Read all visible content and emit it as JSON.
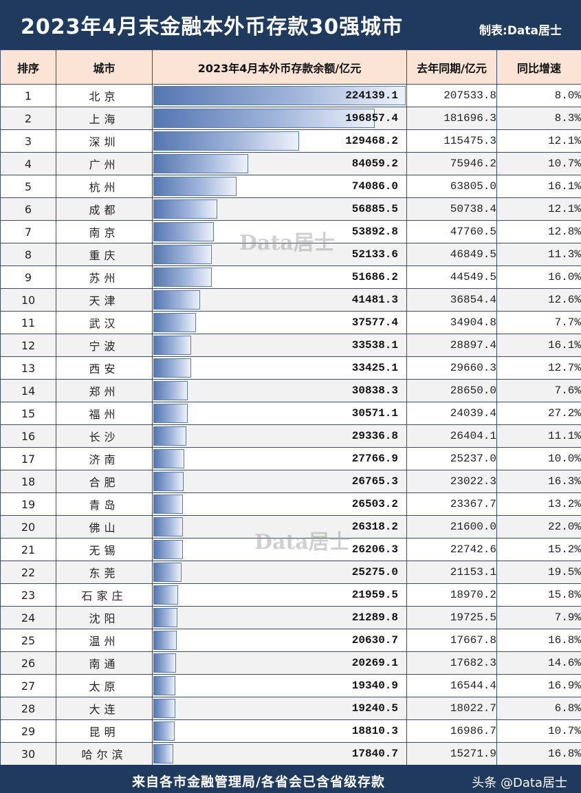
{
  "title": "2023年4月末金融本外币存款30强城市",
  "credit": "制表:Data居士",
  "watermark": "Data居士",
  "footer_source": "来自各市金融管理局/各省会已含省级存款",
  "footer_brand": "头条 @Data居士",
  "colors": {
    "header_bg": "#1f3a5c",
    "header_row_bg": "#fbe3d6",
    "bar": "#5576b0"
  },
  "chart_data": {
    "type": "table",
    "columns": [
      "排序",
      "城市",
      "2023年4月本外币存款余额/亿元",
      "去年同期/亿元",
      "同比增速"
    ],
    "rows": [
      {
        "rank": "1",
        "city": "北京",
        "balance": "224139.1",
        "last_year": "207533.8",
        "growth": "8.0%",
        "value": 224139.1
      },
      {
        "rank": "2",
        "city": "上海",
        "balance": "196857.4",
        "last_year": "181696.3",
        "growth": "8.3%",
        "value": 196857.4
      },
      {
        "rank": "3",
        "city": "深圳",
        "balance": "129468.2",
        "last_year": "115475.3",
        "growth": "12.1%",
        "value": 129468.2
      },
      {
        "rank": "4",
        "city": "广州",
        "balance": "84059.2",
        "last_year": "75946.2",
        "growth": "10.7%",
        "value": 84059.2
      },
      {
        "rank": "5",
        "city": "杭州",
        "balance": "74086.0",
        "last_year": "63805.0",
        "growth": "16.1%",
        "value": 74086.0
      },
      {
        "rank": "6",
        "city": "成都",
        "balance": "56885.5",
        "last_year": "50738.4",
        "growth": "12.1%",
        "value": 56885.5
      },
      {
        "rank": "7",
        "city": "南京",
        "balance": "53892.8",
        "last_year": "47760.5",
        "growth": "12.8%",
        "value": 53892.8
      },
      {
        "rank": "8",
        "city": "重庆",
        "balance": "52133.6",
        "last_year": "46849.5",
        "growth": "11.3%",
        "value": 52133.6
      },
      {
        "rank": "9",
        "city": "苏州",
        "balance": "51686.2",
        "last_year": "44549.5",
        "growth": "16.0%",
        "value": 51686.2
      },
      {
        "rank": "10",
        "city": "天津",
        "balance": "41481.3",
        "last_year": "36854.4",
        "growth": "12.6%",
        "value": 41481.3
      },
      {
        "rank": "11",
        "city": "武汉",
        "balance": "37577.4",
        "last_year": "34904.8",
        "growth": "7.7%",
        "value": 37577.4
      },
      {
        "rank": "12",
        "city": "宁波",
        "balance": "33538.1",
        "last_year": "28897.4",
        "growth": "16.1%",
        "value": 33538.1
      },
      {
        "rank": "13",
        "city": "西安",
        "balance": "33425.1",
        "last_year": "29660.3",
        "growth": "12.7%",
        "value": 33425.1
      },
      {
        "rank": "14",
        "city": "郑州",
        "balance": "30838.3",
        "last_year": "28650.0",
        "growth": "7.6%",
        "value": 30838.3
      },
      {
        "rank": "15",
        "city": "福州",
        "balance": "30571.1",
        "last_year": "24039.4",
        "growth": "27.2%",
        "value": 30571.1
      },
      {
        "rank": "16",
        "city": "长沙",
        "balance": "29336.8",
        "last_year": "26404.1",
        "growth": "11.1%",
        "value": 29336.8
      },
      {
        "rank": "17",
        "city": "济南",
        "balance": "27766.9",
        "last_year": "25237.0",
        "growth": "10.0%",
        "value": 27766.9
      },
      {
        "rank": "18",
        "city": "合肥",
        "balance": "26765.3",
        "last_year": "23022.3",
        "growth": "16.3%",
        "value": 26765.3
      },
      {
        "rank": "19",
        "city": "青岛",
        "balance": "26503.2",
        "last_year": "23367.7",
        "growth": "13.2%",
        "value": 26503.2
      },
      {
        "rank": "20",
        "city": "佛山",
        "balance": "26318.2",
        "last_year": "21600.0",
        "growth": "22.0%",
        "value": 26318.2
      },
      {
        "rank": "21",
        "city": "无锡",
        "balance": "26206.3",
        "last_year": "22742.6",
        "growth": "15.2%",
        "value": 26206.3
      },
      {
        "rank": "22",
        "city": "东莞",
        "balance": "25275.0",
        "last_year": "21153.1",
        "growth": "19.5%",
        "value": 25275.0
      },
      {
        "rank": "23",
        "city": "石家庄",
        "balance": "21959.5",
        "last_year": "18970.2",
        "growth": "15.8%",
        "value": 21959.5
      },
      {
        "rank": "24",
        "city": "沈阳",
        "balance": "21289.8",
        "last_year": "19725.5",
        "growth": "7.9%",
        "value": 21289.8
      },
      {
        "rank": "25",
        "city": "温州",
        "balance": "20630.7",
        "last_year": "17667.8",
        "growth": "16.8%",
        "value": 20630.7
      },
      {
        "rank": "26",
        "city": "南通",
        "balance": "20269.1",
        "last_year": "17682.3",
        "growth": "14.6%",
        "value": 20269.1
      },
      {
        "rank": "27",
        "city": "太原",
        "balance": "19340.9",
        "last_year": "16544.4",
        "growth": "16.9%",
        "value": 19340.9
      },
      {
        "rank": "28",
        "city": "大连",
        "balance": "19240.5",
        "last_year": "18022.7",
        "growth": "6.8%",
        "value": 19240.5
      },
      {
        "rank": "29",
        "city": "昆明",
        "balance": "18810.3",
        "last_year": "16986.7",
        "growth": "10.7%",
        "value": 18810.3
      },
      {
        "rank": "30",
        "city": "哈尔滨",
        "balance": "17840.7",
        "last_year": "15271.9",
        "growth": "16.8%",
        "value": 17840.7
      }
    ]
  }
}
